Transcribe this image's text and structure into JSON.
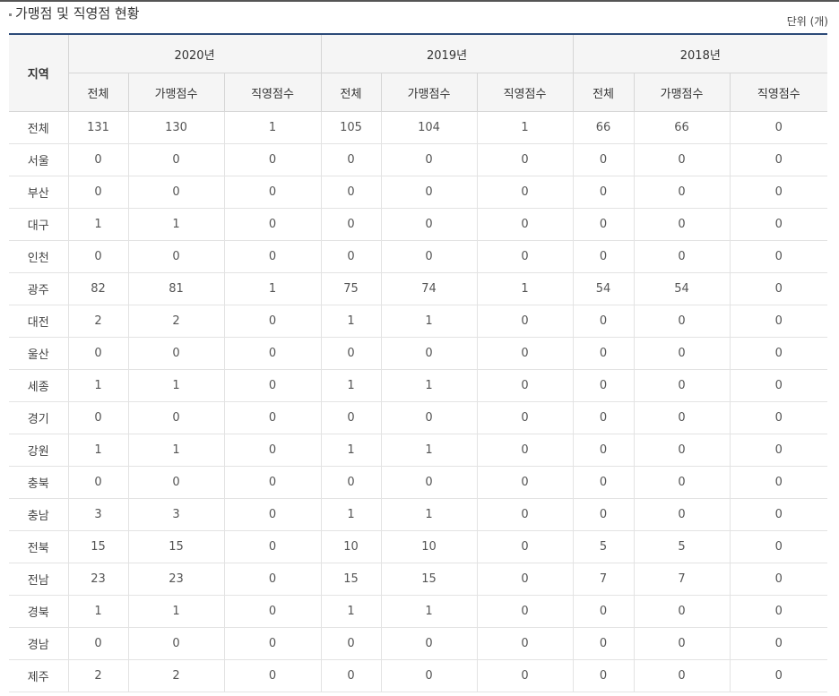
{
  "title": "가맹점 및 직영점 현황",
  "unit": "단위 (개)",
  "colors": {
    "header_top_border": "#2c4a78",
    "header_bg": "#f5f5f5"
  },
  "table": {
    "region_header": "지역",
    "years": [
      "2020년",
      "2019년",
      "2018년"
    ],
    "sub_headers": [
      "전체",
      "가맹점수",
      "직영점수"
    ],
    "rows": [
      {
        "region": "전체",
        "values": [
          "131",
          "130",
          "1",
          "105",
          "104",
          "1",
          "66",
          "66",
          "0"
        ]
      },
      {
        "region": "서울",
        "values": [
          "0",
          "0",
          "0",
          "0",
          "0",
          "0",
          "0",
          "0",
          "0"
        ]
      },
      {
        "region": "부산",
        "values": [
          "0",
          "0",
          "0",
          "0",
          "0",
          "0",
          "0",
          "0",
          "0"
        ]
      },
      {
        "region": "대구",
        "values": [
          "1",
          "1",
          "0",
          "0",
          "0",
          "0",
          "0",
          "0",
          "0"
        ]
      },
      {
        "region": "인천",
        "values": [
          "0",
          "0",
          "0",
          "0",
          "0",
          "0",
          "0",
          "0",
          "0"
        ]
      },
      {
        "region": "광주",
        "values": [
          "82",
          "81",
          "1",
          "75",
          "74",
          "1",
          "54",
          "54",
          "0"
        ]
      },
      {
        "region": "대전",
        "values": [
          "2",
          "2",
          "0",
          "1",
          "1",
          "0",
          "0",
          "0",
          "0"
        ]
      },
      {
        "region": "울산",
        "values": [
          "0",
          "0",
          "0",
          "0",
          "0",
          "0",
          "0",
          "0",
          "0"
        ]
      },
      {
        "region": "세종",
        "values": [
          "1",
          "1",
          "0",
          "1",
          "1",
          "0",
          "0",
          "0",
          "0"
        ]
      },
      {
        "region": "경기",
        "values": [
          "0",
          "0",
          "0",
          "0",
          "0",
          "0",
          "0",
          "0",
          "0"
        ]
      },
      {
        "region": "강원",
        "values": [
          "1",
          "1",
          "0",
          "1",
          "1",
          "0",
          "0",
          "0",
          "0"
        ]
      },
      {
        "region": "충북",
        "values": [
          "0",
          "0",
          "0",
          "0",
          "0",
          "0",
          "0",
          "0",
          "0"
        ]
      },
      {
        "region": "충남",
        "values": [
          "3",
          "3",
          "0",
          "1",
          "1",
          "0",
          "0",
          "0",
          "0"
        ]
      },
      {
        "region": "전북",
        "values": [
          "15",
          "15",
          "0",
          "10",
          "10",
          "0",
          "5",
          "5",
          "0"
        ]
      },
      {
        "region": "전남",
        "values": [
          "23",
          "23",
          "0",
          "15",
          "15",
          "0",
          "7",
          "7",
          "0"
        ]
      },
      {
        "region": "경북",
        "values": [
          "1",
          "1",
          "0",
          "1",
          "1",
          "0",
          "0",
          "0",
          "0"
        ]
      },
      {
        "region": "경남",
        "values": [
          "0",
          "0",
          "0",
          "0",
          "0",
          "0",
          "0",
          "0",
          "0"
        ]
      },
      {
        "region": "제주",
        "values": [
          "2",
          "2",
          "0",
          "0",
          "0",
          "0",
          "0",
          "0",
          "0"
        ]
      }
    ]
  }
}
